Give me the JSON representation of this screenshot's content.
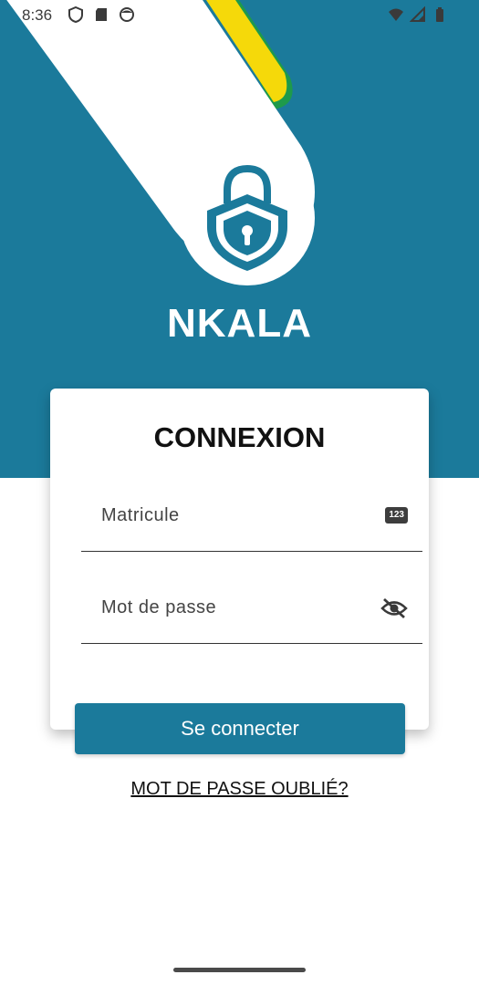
{
  "status_bar": {
    "time": "8:36",
    "icons_left": [
      "shield-icon",
      "sd-card-icon",
      "face-icon"
    ],
    "icons_right": [
      "wifi-icon",
      "signal-icon",
      "battery-icon"
    ]
  },
  "header": {
    "app_name": "NKALA",
    "logo_icon": "padlock-shield-icon"
  },
  "login_card": {
    "title": "CONNEXION",
    "matricule_label": "Matricule",
    "matricule_icon_text": "123",
    "password_label": "Mot de passe",
    "password_icon": "eye-off-icon"
  },
  "actions": {
    "login_button": "Se connecter",
    "forgot_password": "MOT DE PASSE OUBLIÉ?"
  },
  "colors": {
    "primary": "#1b7a9b",
    "accent_yellow": "#f5d90a",
    "accent_green": "#1e9a4b"
  }
}
